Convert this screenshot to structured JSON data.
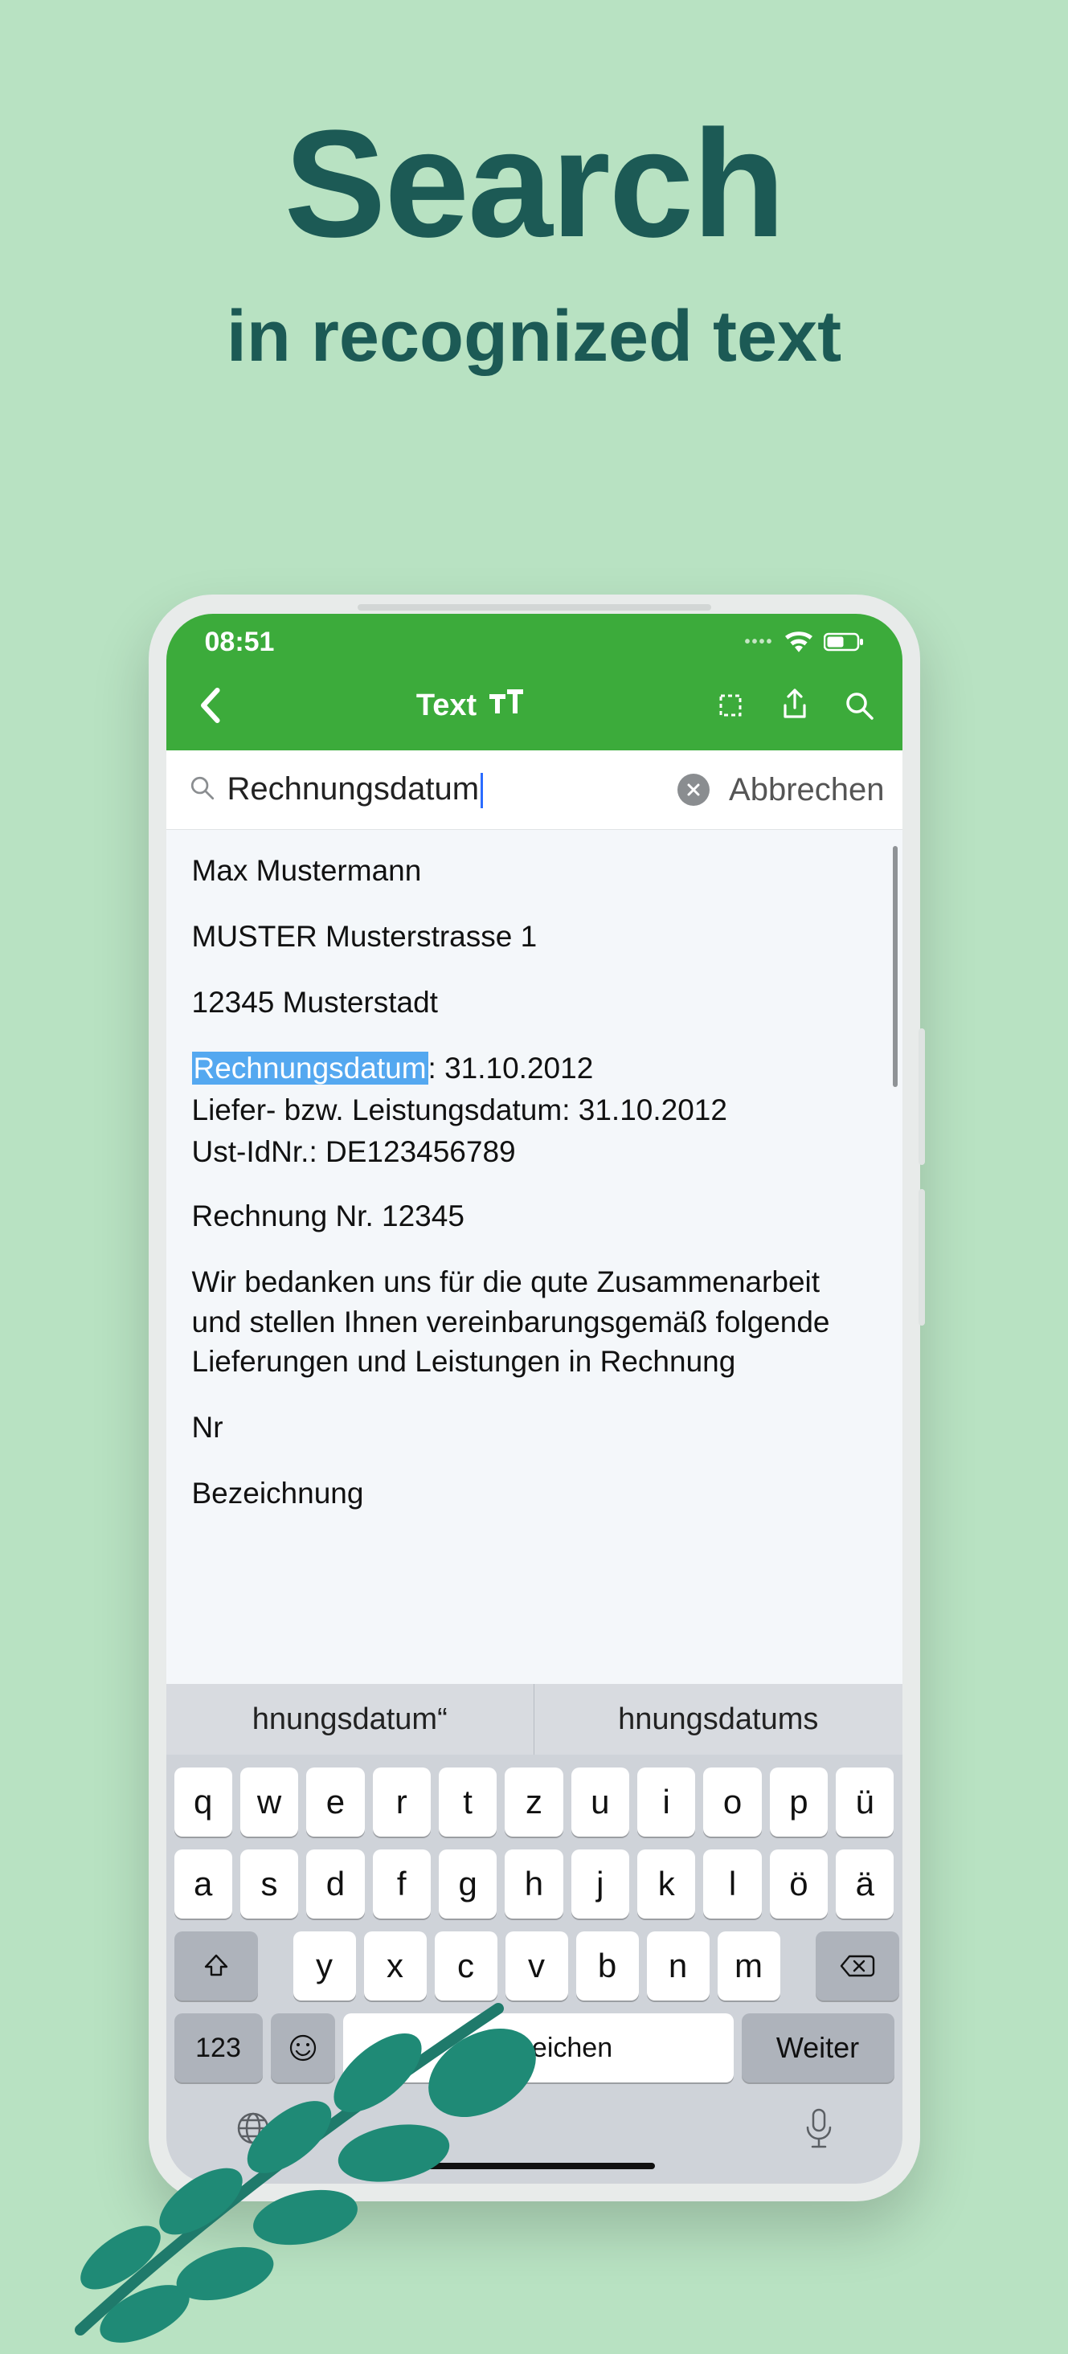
{
  "hero": {
    "title": "Search",
    "subtitle": "in recognized text"
  },
  "status": {
    "time": "08:51"
  },
  "toolbar": {
    "title": "Text"
  },
  "search": {
    "query": "Rechnungsdatum",
    "cancel": "Abbrechen"
  },
  "doc": {
    "name": "Max Mustermann",
    "street": "MUSTER Musterstrasse 1",
    "city": "12345 Musterstadt",
    "rd_label": "Rechnungsdatum",
    "rd_rest": ": 31.10.2012",
    "ld": "Liefer- bzw. Leistungsdatum: 31.10.2012",
    "ust": "Ust-IdNr.: DE123456789",
    "rnr": "Rechnung Nr. 12345",
    "body": "Wir bedanken uns für die qute Zusammenarbeit und stellen Ihnen vereinbarungsgemäß folgende Lieferungen und Leistungen in Rechnung",
    "nr": "Nr",
    "bez": "Bezeichnung"
  },
  "suggestions": [
    "hnungsdatum“",
    "hnungsdatums"
  ],
  "keys": {
    "row1": [
      "q",
      "w",
      "e",
      "r",
      "t",
      "z",
      "u",
      "i",
      "o",
      "p",
      "ü"
    ],
    "row2": [
      "a",
      "s",
      "d",
      "f",
      "g",
      "h",
      "j",
      "k",
      "l",
      "ö",
      "ä"
    ],
    "row3": [
      "y",
      "x",
      "c",
      "v",
      "b",
      "n",
      "m"
    ],
    "num": "123",
    "space": "Leerzeichen",
    "enter": "Weiter"
  }
}
